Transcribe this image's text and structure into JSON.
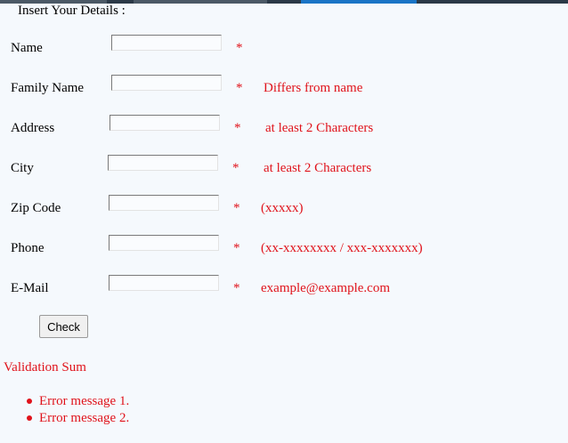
{
  "form": {
    "legend": "Insert Your Details :",
    "required_mark": "*",
    "fields": [
      {
        "label": "Name",
        "value": "",
        "hint": ""
      },
      {
        "label": "Family Name",
        "value": "",
        "hint": "Differs from name"
      },
      {
        "label": "Address",
        "value": "",
        "hint": "at least 2 Characters"
      },
      {
        "label": "City",
        "value": "",
        "hint": "at least 2 Characters"
      },
      {
        "label": "Zip Code",
        "value": "",
        "hint": "(xxxxx)"
      },
      {
        "label": "Phone",
        "value": "",
        "hint": "(xx-xxxxxxxx / xxx-xxxxxxx)"
      },
      {
        "label": "E-Mail",
        "value": "",
        "hint": "example@example.com"
      }
    ],
    "check_label": "Check"
  },
  "validation": {
    "title": "Validation Sum",
    "errors": [
      "Error message 1.",
      "Error message 2."
    ]
  },
  "colors": {
    "error_red": "#e0131b",
    "background": "#f5f9fd",
    "top_bar": "#2b3947",
    "top_bar_active": "#1a74c6"
  }
}
